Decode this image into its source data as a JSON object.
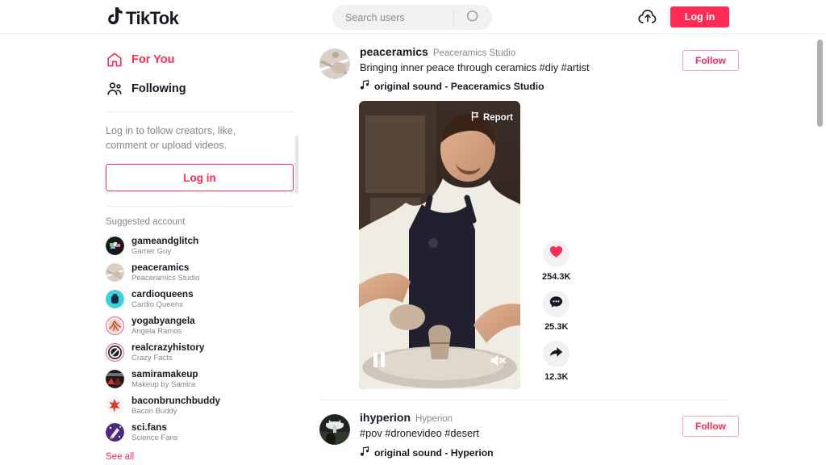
{
  "brand": {
    "name": "TikTok",
    "accent": "#fe2c55",
    "icon": "tiktok-note-icon"
  },
  "header": {
    "search": {
      "placeholder": "Search users",
      "value": "",
      "icon": "search-icon"
    },
    "upload_icon": "upload-cloud-icon",
    "login_label": "Log in"
  },
  "sidebar": {
    "nav": [
      {
        "label": "For You",
        "icon": "home-icon",
        "active": true
      },
      {
        "label": "Following",
        "icon": "people-icon",
        "active": false
      }
    ],
    "login_prompt": "Log in to follow creators, like, comment or upload videos.",
    "login_label": "Log in",
    "suggested_title": "Suggested account",
    "accounts": [
      {
        "handle": "gameandglitch",
        "name": "Gamer Guy",
        "avatar": "avatar-gameandglitch"
      },
      {
        "handle": "peaceramics",
        "name": "Peaceramics Studio",
        "avatar": "avatar-peaceramics"
      },
      {
        "handle": "cardioqueens",
        "name": "Cardio Queens",
        "avatar": "avatar-cardioqueens"
      },
      {
        "handle": "yogabyangela",
        "name": "Angela Ramos",
        "avatar": "avatar-yogabyangela"
      },
      {
        "handle": "realcrazyhistory",
        "name": "Crazy Facts",
        "avatar": "avatar-realcrazyhistory"
      },
      {
        "handle": "samiramakeup",
        "name": "Makeup by Samira",
        "avatar": "avatar-samiramakeup"
      },
      {
        "handle": "baconbrunchbuddy",
        "name": "Bacon Buddy",
        "avatar": "avatar-baconbrunchbuddy"
      },
      {
        "handle": "sci.fans",
        "name": "Science Fans",
        "avatar": "avatar-scifans"
      }
    ],
    "see_all_label": "See all"
  },
  "feed": {
    "posts": [
      {
        "handle": "peaceramics",
        "nickname": "Peaceramics Studio",
        "caption": "Bringing inner peace through ceramics #diy #artist",
        "sound": "original sound - Peaceramics Studio",
        "sound_icon": "music-note-icon",
        "follow_label": "Follow",
        "report_label": "Report",
        "report_icon": "flag-icon",
        "play_state_icon": "pause-icon",
        "mute_state_icon": "volume-muted-icon",
        "actions": [
          {
            "icon": "heart-icon",
            "count": "254.3K"
          },
          {
            "icon": "comment-icon",
            "count": "25.3K"
          },
          {
            "icon": "share-icon",
            "count": "12.3K"
          }
        ]
      },
      {
        "handle": "ihyperion",
        "nickname": "Hyperion",
        "caption": "#pov #dronevideo #desert",
        "sound": "original sound - Hyperion",
        "sound_icon": "music-note-icon",
        "follow_label": "Follow"
      }
    ]
  }
}
